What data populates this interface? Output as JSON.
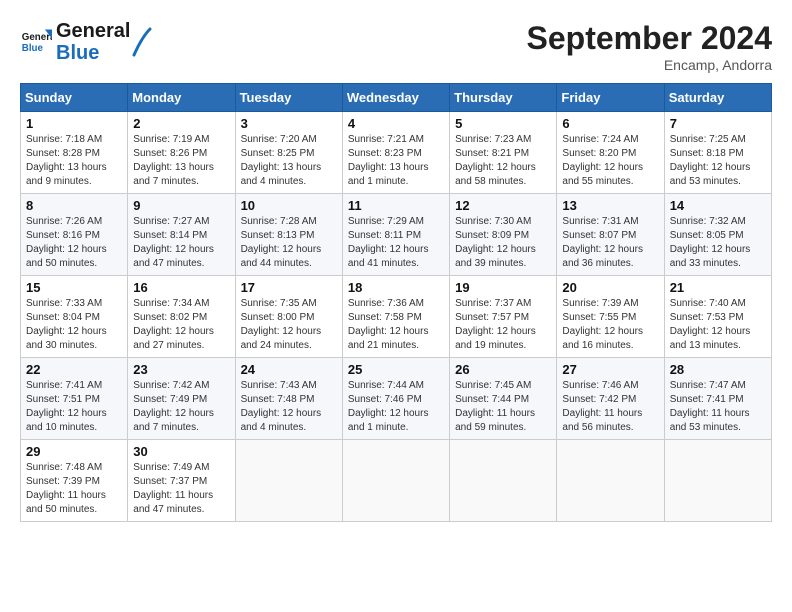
{
  "header": {
    "logo_line1": "General",
    "logo_line2": "Blue",
    "month": "September 2024",
    "location": "Encamp, Andorra"
  },
  "days_of_week": [
    "Sunday",
    "Monday",
    "Tuesday",
    "Wednesday",
    "Thursday",
    "Friday",
    "Saturday"
  ],
  "weeks": [
    [
      {
        "day": "1",
        "info": "Sunrise: 7:18 AM\nSunset: 8:28 PM\nDaylight: 13 hours\nand 9 minutes."
      },
      {
        "day": "2",
        "info": "Sunrise: 7:19 AM\nSunset: 8:26 PM\nDaylight: 13 hours\nand 7 minutes."
      },
      {
        "day": "3",
        "info": "Sunrise: 7:20 AM\nSunset: 8:25 PM\nDaylight: 13 hours\nand 4 minutes."
      },
      {
        "day": "4",
        "info": "Sunrise: 7:21 AM\nSunset: 8:23 PM\nDaylight: 13 hours\nand 1 minute."
      },
      {
        "day": "5",
        "info": "Sunrise: 7:23 AM\nSunset: 8:21 PM\nDaylight: 12 hours\nand 58 minutes."
      },
      {
        "day": "6",
        "info": "Sunrise: 7:24 AM\nSunset: 8:20 PM\nDaylight: 12 hours\nand 55 minutes."
      },
      {
        "day": "7",
        "info": "Sunrise: 7:25 AM\nSunset: 8:18 PM\nDaylight: 12 hours\nand 53 minutes."
      }
    ],
    [
      {
        "day": "8",
        "info": "Sunrise: 7:26 AM\nSunset: 8:16 PM\nDaylight: 12 hours\nand 50 minutes."
      },
      {
        "day": "9",
        "info": "Sunrise: 7:27 AM\nSunset: 8:14 PM\nDaylight: 12 hours\nand 47 minutes."
      },
      {
        "day": "10",
        "info": "Sunrise: 7:28 AM\nSunset: 8:13 PM\nDaylight: 12 hours\nand 44 minutes."
      },
      {
        "day": "11",
        "info": "Sunrise: 7:29 AM\nSunset: 8:11 PM\nDaylight: 12 hours\nand 41 minutes."
      },
      {
        "day": "12",
        "info": "Sunrise: 7:30 AM\nSunset: 8:09 PM\nDaylight: 12 hours\nand 39 minutes."
      },
      {
        "day": "13",
        "info": "Sunrise: 7:31 AM\nSunset: 8:07 PM\nDaylight: 12 hours\nand 36 minutes."
      },
      {
        "day": "14",
        "info": "Sunrise: 7:32 AM\nSunset: 8:05 PM\nDaylight: 12 hours\nand 33 minutes."
      }
    ],
    [
      {
        "day": "15",
        "info": "Sunrise: 7:33 AM\nSunset: 8:04 PM\nDaylight: 12 hours\nand 30 minutes."
      },
      {
        "day": "16",
        "info": "Sunrise: 7:34 AM\nSunset: 8:02 PM\nDaylight: 12 hours\nand 27 minutes."
      },
      {
        "day": "17",
        "info": "Sunrise: 7:35 AM\nSunset: 8:00 PM\nDaylight: 12 hours\nand 24 minutes."
      },
      {
        "day": "18",
        "info": "Sunrise: 7:36 AM\nSunset: 7:58 PM\nDaylight: 12 hours\nand 21 minutes."
      },
      {
        "day": "19",
        "info": "Sunrise: 7:37 AM\nSunset: 7:57 PM\nDaylight: 12 hours\nand 19 minutes."
      },
      {
        "day": "20",
        "info": "Sunrise: 7:39 AM\nSunset: 7:55 PM\nDaylight: 12 hours\nand 16 minutes."
      },
      {
        "day": "21",
        "info": "Sunrise: 7:40 AM\nSunset: 7:53 PM\nDaylight: 12 hours\nand 13 minutes."
      }
    ],
    [
      {
        "day": "22",
        "info": "Sunrise: 7:41 AM\nSunset: 7:51 PM\nDaylight: 12 hours\nand 10 minutes."
      },
      {
        "day": "23",
        "info": "Sunrise: 7:42 AM\nSunset: 7:49 PM\nDaylight: 12 hours\nand 7 minutes."
      },
      {
        "day": "24",
        "info": "Sunrise: 7:43 AM\nSunset: 7:48 PM\nDaylight: 12 hours\nand 4 minutes."
      },
      {
        "day": "25",
        "info": "Sunrise: 7:44 AM\nSunset: 7:46 PM\nDaylight: 12 hours\nand 1 minute."
      },
      {
        "day": "26",
        "info": "Sunrise: 7:45 AM\nSunset: 7:44 PM\nDaylight: 11 hours\nand 59 minutes."
      },
      {
        "day": "27",
        "info": "Sunrise: 7:46 AM\nSunset: 7:42 PM\nDaylight: 11 hours\nand 56 minutes."
      },
      {
        "day": "28",
        "info": "Sunrise: 7:47 AM\nSunset: 7:41 PM\nDaylight: 11 hours\nand 53 minutes."
      }
    ],
    [
      {
        "day": "29",
        "info": "Sunrise: 7:48 AM\nSunset: 7:39 PM\nDaylight: 11 hours\nand 50 minutes."
      },
      {
        "day": "30",
        "info": "Sunrise: 7:49 AM\nSunset: 7:37 PM\nDaylight: 11 hours\nand 47 minutes."
      },
      {
        "day": "",
        "info": ""
      },
      {
        "day": "",
        "info": ""
      },
      {
        "day": "",
        "info": ""
      },
      {
        "day": "",
        "info": ""
      },
      {
        "day": "",
        "info": ""
      }
    ]
  ]
}
